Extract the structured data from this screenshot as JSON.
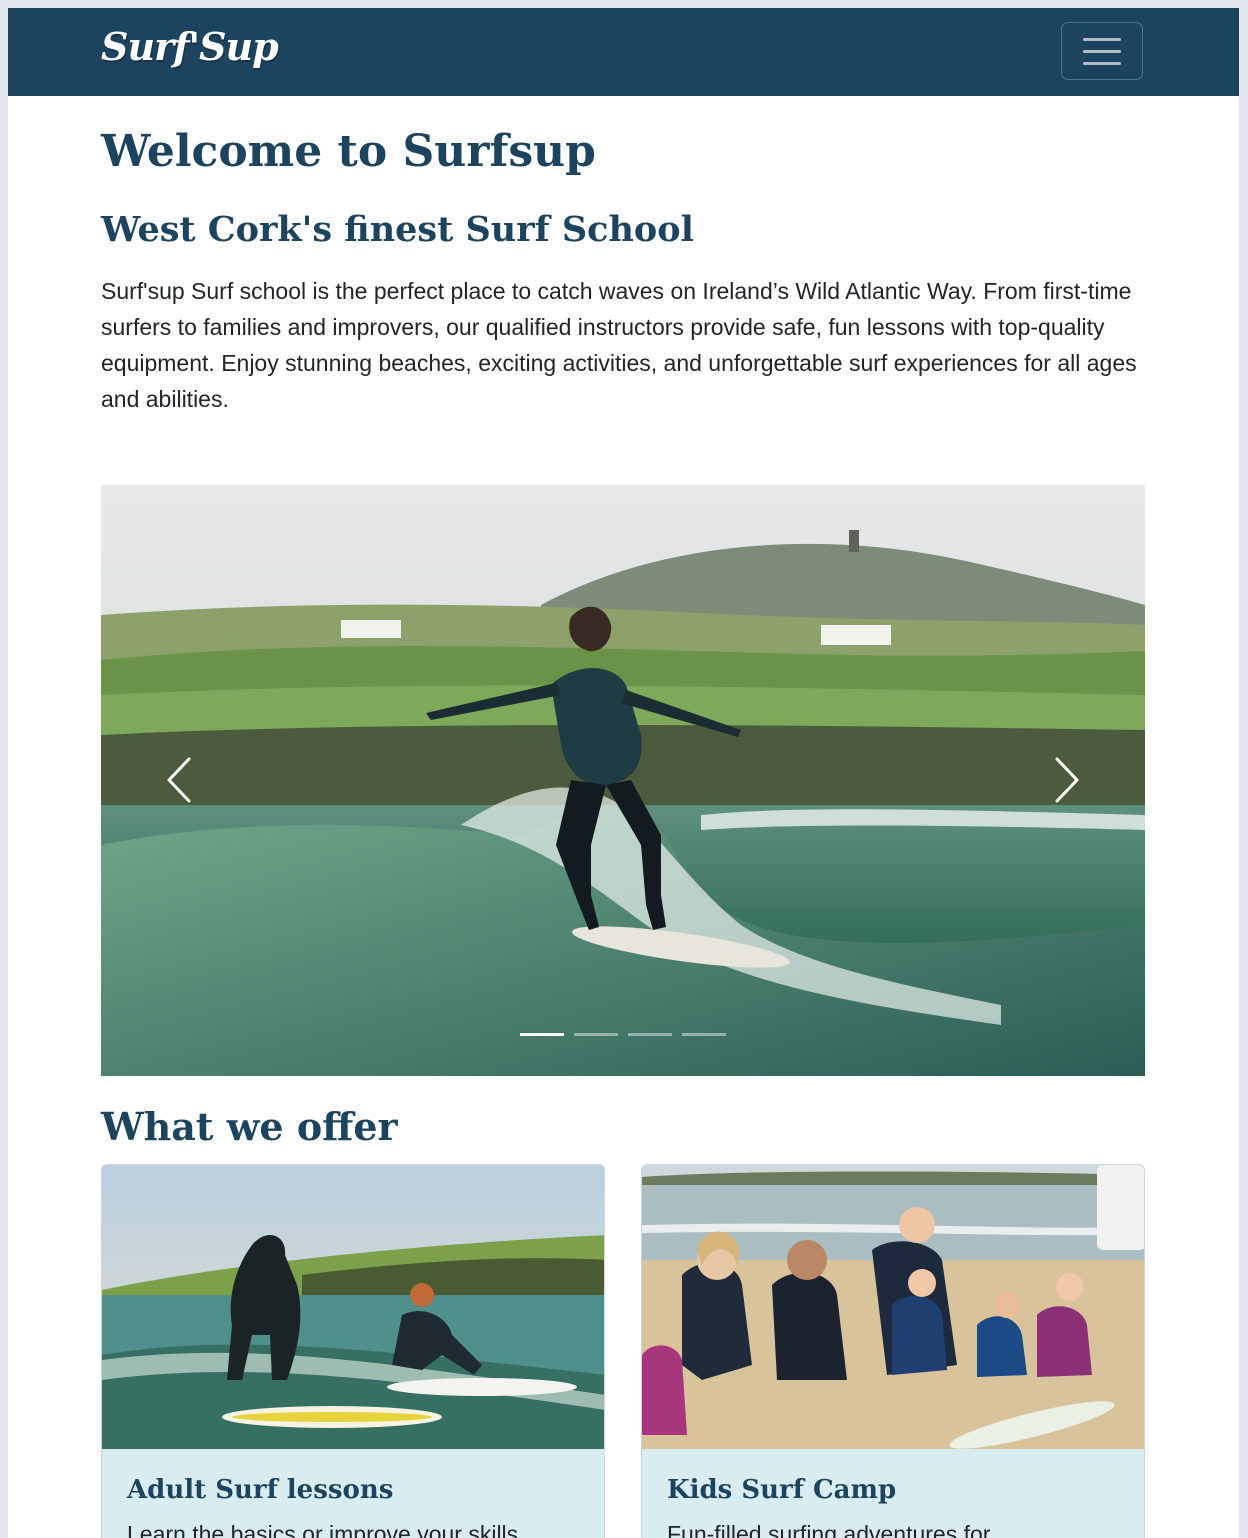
{
  "navbar": {
    "brand": "Surf'Sup",
    "menu_icon": "hamburger-menu-icon"
  },
  "hero": {
    "title": "Welcome to Surfsup",
    "subtitle": "West Cork's finest Surf School",
    "intro": "Surf'sup Surf school is the perfect place to catch waves on Ireland’s Wild Atlantic Way. From first-time surfers to families and improvers, our qualified instructors provide safe, fun lessons with top-quality equipment. Enjoy stunning beaches, exciting activities, and unforgettable surf experiences for all ages and abilities."
  },
  "carousel": {
    "prev_icon": "chevron-left-icon",
    "next_icon": "chevron-right-icon",
    "slide_count": 4,
    "active_slide": 1
  },
  "offers": {
    "heading": "What we offer",
    "cards": [
      {
        "title": "Adult Surf lessons",
        "text": "Learn the basics or improve your skills"
      },
      {
        "title": "Kids Surf Camp",
        "text": "Fun-filled surfing adventures for"
      }
    ]
  },
  "colors": {
    "brand": "#1d445e",
    "card_body": "#d9edf1"
  }
}
